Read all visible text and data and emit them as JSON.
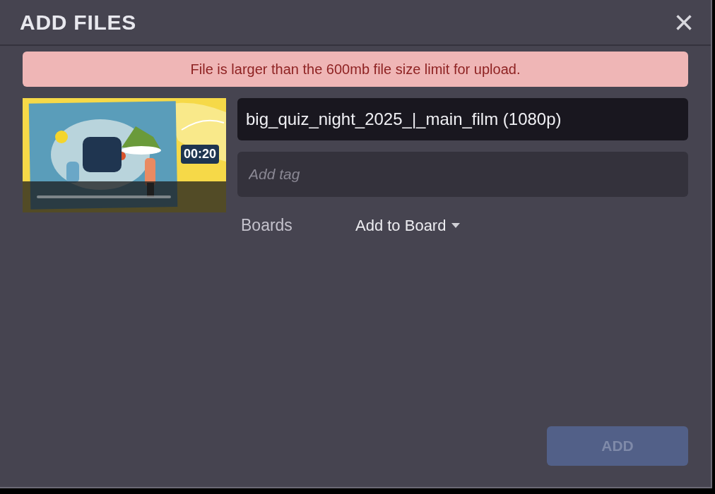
{
  "dialog": {
    "title": "ADD FILES",
    "close": "×"
  },
  "alert": {
    "message": "File is larger than the 600mb file size limit for upload."
  },
  "file": {
    "thumbnail": {
      "kind": "picture",
      "duration": "00:20"
    },
    "name_field": {
      "value": "big_quiz_night_2025_|_main_film (1080p)"
    },
    "tag_field": {
      "placeholder": "Add tag"
    },
    "boards": {
      "label": "Boards",
      "dropdown": "Add to Board"
    }
  },
  "add_button": {
    "label": "ADD",
    "disabled": true
  }
}
